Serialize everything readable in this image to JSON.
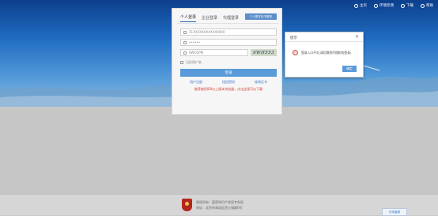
{
  "header": {
    "nav": [
      {
        "label": "主页",
        "icon": "home-icon"
      },
      {
        "label": "环境检测",
        "icon": "monitor-icon"
      },
      {
        "label": "下载",
        "icon": "download-icon"
      },
      {
        "label": "帮助",
        "icon": "help-icon"
      }
    ]
  },
  "login": {
    "tabs": [
      "个人登录",
      "企业登录",
      "代理登录"
    ],
    "active_tab": "个人登录",
    "cert_button": "个人数字证书登录",
    "username_value": "51XXXXXXXXXXX0000",
    "password_value": "••••••",
    "captcha_input": "9WQ5PM",
    "captcha_image": "9WH553",
    "remember_label": "记住用户名",
    "login_button": "登录",
    "links": [
      "用户注册",
      "找回密码",
      "修改证书"
    ],
    "notice": "推荐使用IE9以上版本浏览器，点击这里可以下载"
  },
  "dialog": {
    "title": "提示",
    "message": "登录入口不对,请切换到代理机构登录!",
    "ok_button": "确定"
  },
  "footer": {
    "line1": "版权所有：国家知识产权局专利局",
    "line2": "地址：北京市海淀区西土城路6号",
    "badge": "在线客服"
  },
  "colors": {
    "accent": "#5a9ad8",
    "hero_top": "#0c3f8c",
    "notice": "#d23b2f"
  }
}
